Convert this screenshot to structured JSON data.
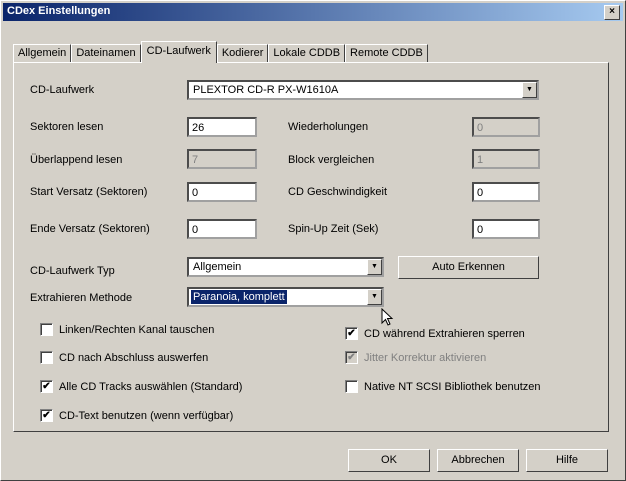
{
  "window": {
    "title": "CDex Einstellungen",
    "close": "×"
  },
  "tabs": [
    "Allgemein",
    "Dateinamen",
    "CD-Laufwerk",
    "Kodierer",
    "Lokale CDDB",
    "Remote CDDB"
  ],
  "form": {
    "drive_label": "CD-Laufwerk",
    "drive_value": "PLEXTOR CD-R   PX-W1610A",
    "sectors_label": "Sektoren lesen",
    "sectors_value": "26",
    "retries_label": "Wiederholungen",
    "retries_value": "0",
    "overlap_label": "Überlappend lesen",
    "overlap_value": "7",
    "compare_label": "Block vergleichen",
    "compare_value": "1",
    "start_offset_label": "Start Versatz (Sektoren)",
    "start_offset_value": "0",
    "speed_label": "CD Geschwindigkeit",
    "speed_value": "0",
    "end_offset_label": "Ende Versatz (Sektoren)",
    "end_offset_value": "0",
    "spinup_label": "Spin-Up Zeit (Sek)",
    "spinup_value": "0",
    "drive_type_label": "CD-Laufwerk Typ",
    "drive_type_value": "Allgemein",
    "auto_detect": "Auto Erkennen",
    "method_label": "Extrahieren Methode",
    "method_value": "Paranoia, komplett"
  },
  "checks": {
    "swap": {
      "label": "Linken/Rechten Kanal tauschen",
      "checked": false
    },
    "lock": {
      "label": "CD während Extrahieren sperren",
      "checked": true
    },
    "eject": {
      "label": "CD nach Abschluss auswerfen",
      "checked": false
    },
    "jitter": {
      "label": "Jitter Korrektur aktivieren",
      "checked": true,
      "disabled": true
    },
    "all_tracks": {
      "label": "Alle CD Tracks auswählen (Standard)",
      "checked": true
    },
    "native_scsi": {
      "label": "Native NT SCSI Bibliothek benutzen",
      "checked": false
    },
    "cdtext": {
      "label": "CD-Text benutzen (wenn verfügbar)",
      "checked": true
    }
  },
  "buttons": {
    "ok": "OK",
    "cancel": "Abbrechen",
    "help": "Hilfe"
  },
  "check_mark": "✔",
  "dropdown_arrow": "▼"
}
